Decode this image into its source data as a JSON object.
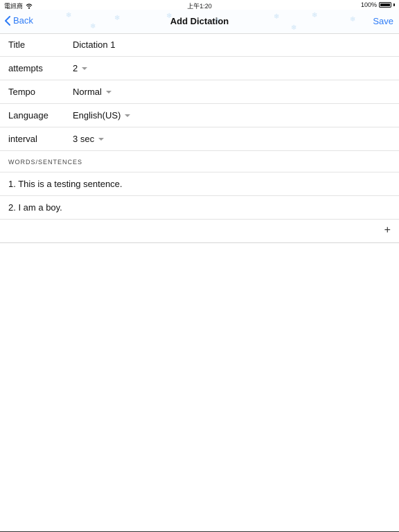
{
  "status_bar": {
    "carrier": "電訊商",
    "time": "上午1:20",
    "battery": "100%"
  },
  "nav": {
    "back_label": "Back",
    "title": "Add Dictation",
    "save_label": "Save"
  },
  "form": {
    "rows": [
      {
        "label": "Title",
        "value": "Dictation 1",
        "dropdown": false
      },
      {
        "label": "attempts",
        "value": "2",
        "dropdown": true
      },
      {
        "label": "Tempo",
        "value": "Normal",
        "dropdown": true
      },
      {
        "label": "Language",
        "value": "English(US)",
        "dropdown": true
      },
      {
        "label": "interval",
        "value": "3 sec",
        "dropdown": true
      }
    ]
  },
  "section": {
    "header": "WORDS/SENTENCES",
    "items": [
      "1. This is a testing sentence.",
      "2. I am a boy."
    ],
    "add_symbol": "+"
  }
}
